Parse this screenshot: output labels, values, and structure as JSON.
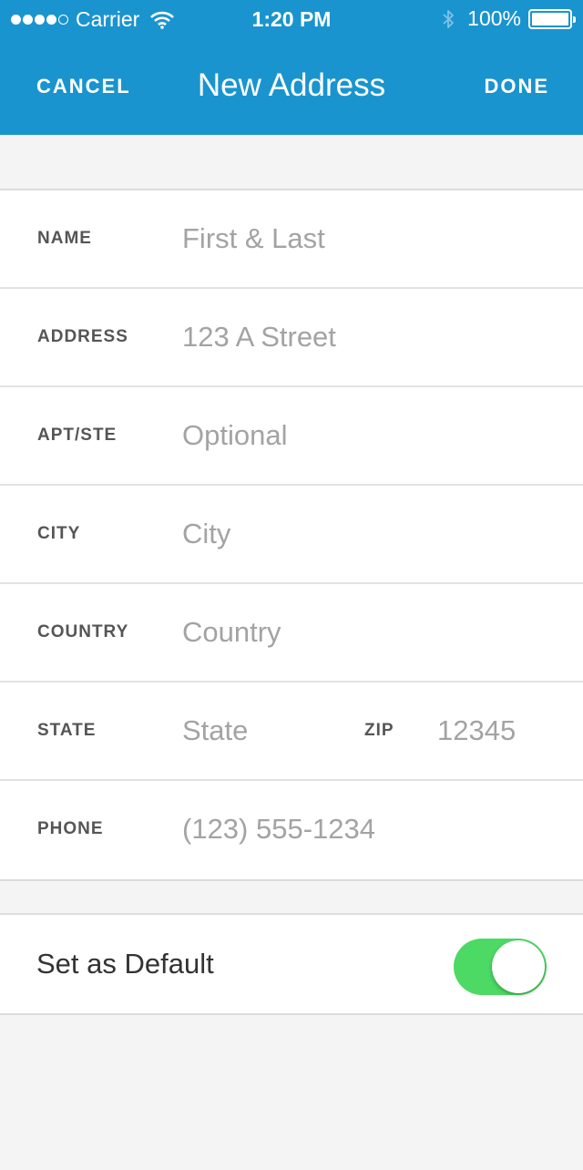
{
  "status_bar": {
    "carrier": "Carrier",
    "time": "1:20 PM",
    "battery": "100%"
  },
  "nav": {
    "cancel_label": "CANCEL",
    "title": "New Address",
    "done_label": "DONE"
  },
  "form": {
    "name": {
      "label": "NAME",
      "placeholder": "First & Last"
    },
    "address": {
      "label": "ADDRESS",
      "placeholder": "123 A Street"
    },
    "apt": {
      "label": "APT/STE",
      "placeholder": "Optional"
    },
    "city": {
      "label": "CITY",
      "placeholder": "City"
    },
    "country": {
      "label": "COUNTRY",
      "placeholder": "Country"
    },
    "state": {
      "label": "STATE",
      "placeholder": "State"
    },
    "zip": {
      "label": "ZIP",
      "placeholder": "12345"
    },
    "phone": {
      "label": "PHONE",
      "placeholder": "(123) 555-1234"
    }
  },
  "default": {
    "label": "Set as Default",
    "enabled": true
  },
  "colors": {
    "header": "#1a94cf",
    "toggle_on": "#4cd964"
  }
}
